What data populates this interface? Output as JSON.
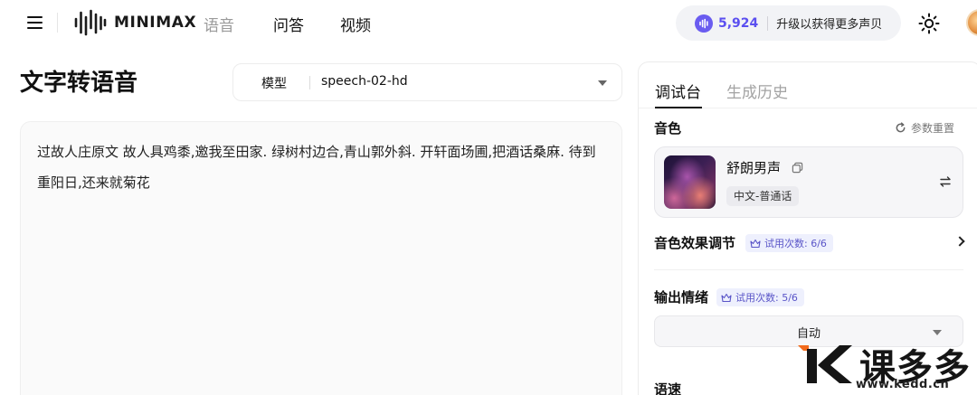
{
  "header": {
    "brand": "MINIMAX",
    "nav": [
      {
        "label": "语音",
        "active": false
      },
      {
        "label": "问答",
        "active": true
      },
      {
        "label": "视频",
        "active": true
      }
    ],
    "credits": {
      "amount": "5,924",
      "upgrade_label": "升级以获得更多声贝"
    },
    "icons": [
      "menu-icon",
      "minimax-logo",
      "sound-wave-icon",
      "sun-icon",
      "avatar"
    ]
  },
  "main": {
    "title": "文字转语音",
    "model": {
      "label": "模型",
      "value": "speech-02-hd"
    },
    "text": "过故人庄原文 故人具鸡黍,邀我至田家. 绿树村边合,青山郭外斜. 开轩面场圃,把酒话桑麻. 待到重阳日,还来就菊花"
  },
  "panel": {
    "tabs": [
      {
        "label": "调试台",
        "active": true
      },
      {
        "label": "生成历史",
        "active": false
      }
    ],
    "voice_section": {
      "label": "音色",
      "reset_label": "参数重置",
      "voice_name": "舒朗男声",
      "voice_tag": "中文-普通话"
    },
    "effect": {
      "label": "音色效果调节",
      "trial": "试用次数: 6/6"
    },
    "emotion": {
      "label": "输出情绪",
      "trial": "试用次数: 5/6",
      "value": "自动"
    },
    "speed": {
      "label": "语速"
    }
  },
  "watermark": {
    "text": "课多多",
    "url": "www.kedd.cn"
  },
  "colors": {
    "accent": "#5b4ff0",
    "watermark_orange": "#f26a1b",
    "panel_bg": "#f6f6f8"
  }
}
